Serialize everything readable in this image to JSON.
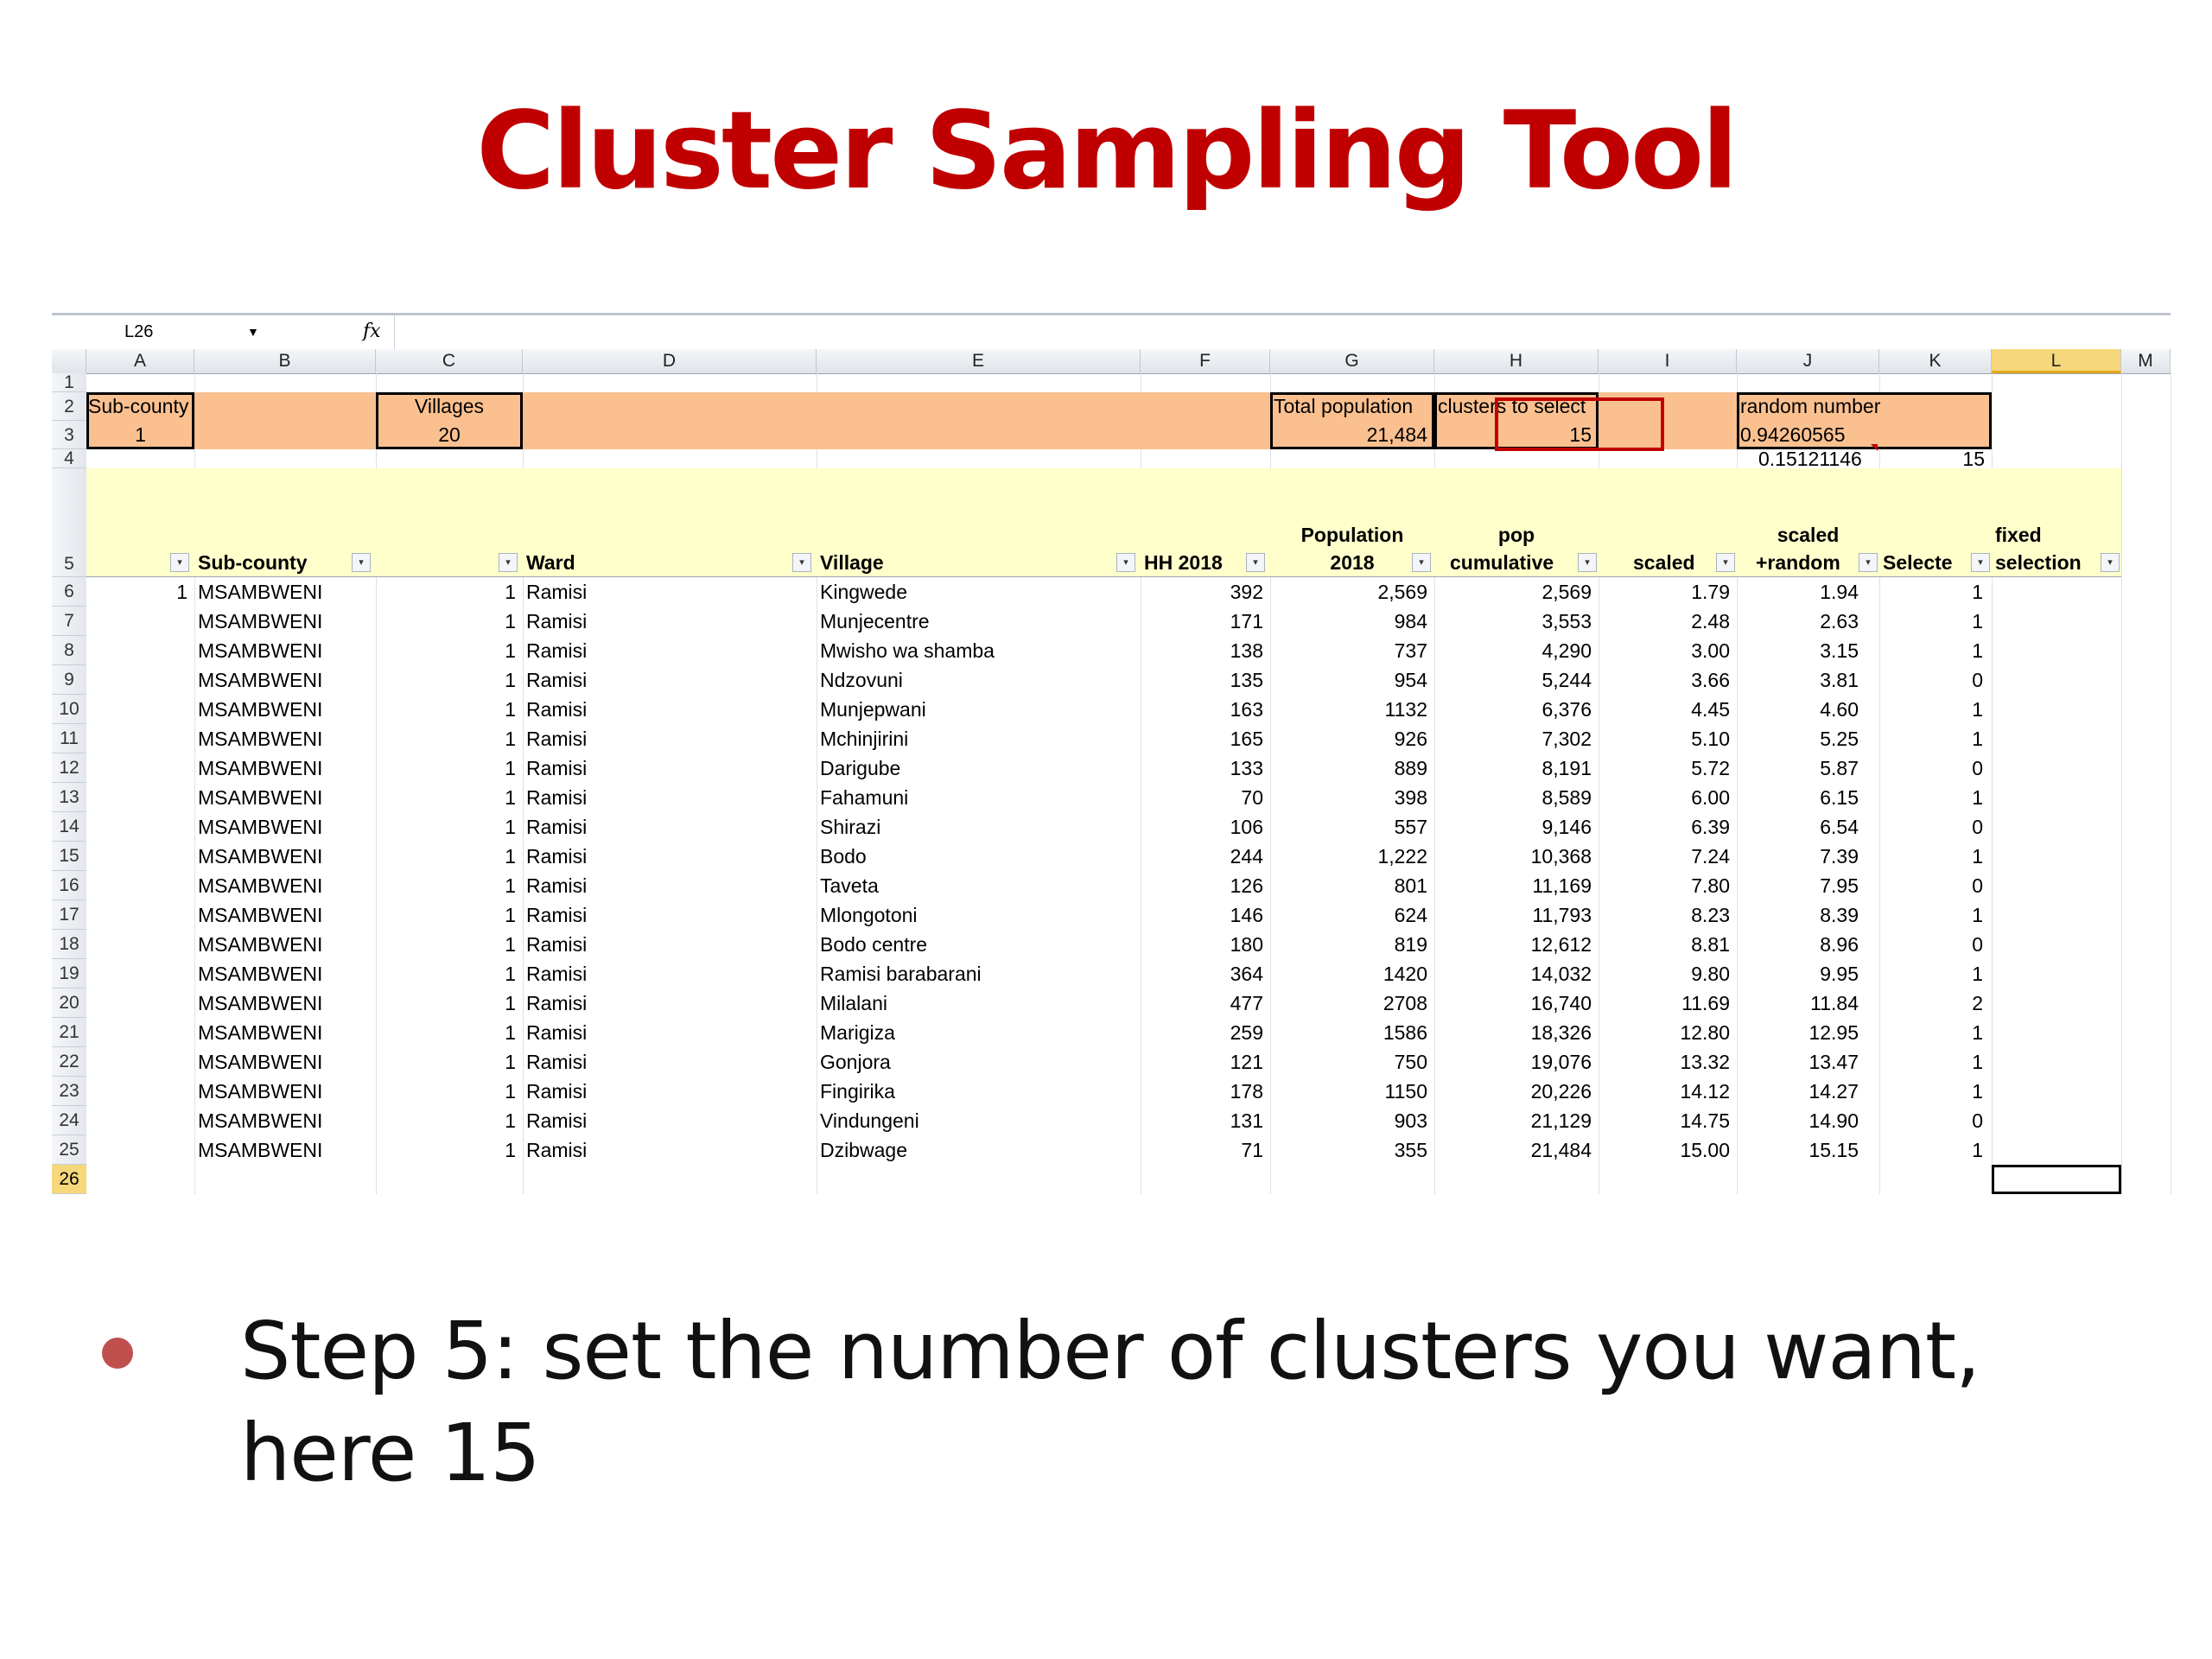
{
  "slide": {
    "title": "Cluster Sampling Tool",
    "bullet": "Step 5: set the number of clusters you want, here 15"
  },
  "sheet": {
    "name_box": "L26",
    "fx_label": "fx",
    "columns": [
      "A",
      "B",
      "C",
      "D",
      "E",
      "F",
      "G",
      "H",
      "I",
      "J",
      "K",
      "L",
      "M"
    ],
    "summary": {
      "subcounty_label": "Sub-county",
      "subcounty_value": "1",
      "villages_label": "Villages",
      "villages_value": "20",
      "total_pop_label": "Total population",
      "total_pop_value": "21,484",
      "clusters_label": "clusters to select",
      "clusters_value": "15",
      "random_label": "random number",
      "random_value": "0.94260565",
      "step_value": "0.15121146",
      "k4_value": "15"
    },
    "headers": {
      "sub_county": "Sub-county",
      "ward": "Ward",
      "village": "Village",
      "hh": "HH 2018",
      "population_1": "Population",
      "population_2": "2018",
      "pop_cum_1": "pop",
      "pop_cum_2": "cumulative",
      "scaled": "scaled",
      "scaled_random_1": "scaled",
      "scaled_random_2": "+random",
      "selected": "Selecte",
      "fixed_1": "fixed",
      "fixed_2": "selection"
    },
    "rows": [
      {
        "n": "6",
        "a": "1",
        "subcounty": "MSAMBWENI",
        "c": "1",
        "ward": "Ramisi",
        "village": "Kingwede",
        "hh": "392",
        "pop": "2,569",
        "cum": "2,569",
        "scaled": "1.79",
        "sr": "1.94",
        "sel": "1"
      },
      {
        "n": "7",
        "a": "",
        "subcounty": "MSAMBWENI",
        "c": "1",
        "ward": "Ramisi",
        "village": "Munjecentre",
        "hh": "171",
        "pop": "984",
        "cum": "3,553",
        "scaled": "2.48",
        "sr": "2.63",
        "sel": "1"
      },
      {
        "n": "8",
        "a": "",
        "subcounty": "MSAMBWENI",
        "c": "1",
        "ward": "Ramisi",
        "village": "Mwisho wa shamba",
        "hh": "138",
        "pop": "737",
        "cum": "4,290",
        "scaled": "3.00",
        "sr": "3.15",
        "sel": "1"
      },
      {
        "n": "9",
        "a": "",
        "subcounty": "MSAMBWENI",
        "c": "1",
        "ward": "Ramisi",
        "village": "Ndzovuni",
        "hh": "135",
        "pop": "954",
        "cum": "5,244",
        "scaled": "3.66",
        "sr": "3.81",
        "sel": "0"
      },
      {
        "n": "10",
        "a": "",
        "subcounty": "MSAMBWENI",
        "c": "1",
        "ward": "Ramisi",
        "village": "Munjepwani",
        "hh": "163",
        "pop": "1132",
        "cum": "6,376",
        "scaled": "4.45",
        "sr": "4.60",
        "sel": "1"
      },
      {
        "n": "11",
        "a": "",
        "subcounty": "MSAMBWENI",
        "c": "1",
        "ward": "Ramisi",
        "village": "Mchinjirini",
        "hh": "165",
        "pop": "926",
        "cum": "7,302",
        "scaled": "5.10",
        "sr": "5.25",
        "sel": "1"
      },
      {
        "n": "12",
        "a": "",
        "subcounty": "MSAMBWENI",
        "c": "1",
        "ward": "Ramisi",
        "village": "Darigube",
        "hh": "133",
        "pop": "889",
        "cum": "8,191",
        "scaled": "5.72",
        "sr": "5.87",
        "sel": "0"
      },
      {
        "n": "13",
        "a": "",
        "subcounty": "MSAMBWENI",
        "c": "1",
        "ward": "Ramisi",
        "village": "Fahamuni",
        "hh": "70",
        "pop": "398",
        "cum": "8,589",
        "scaled": "6.00",
        "sr": "6.15",
        "sel": "1"
      },
      {
        "n": "14",
        "a": "",
        "subcounty": "MSAMBWENI",
        "c": "1",
        "ward": "Ramisi",
        "village": "Shirazi",
        "hh": "106",
        "pop": "557",
        "cum": "9,146",
        "scaled": "6.39",
        "sr": "6.54",
        "sel": "0"
      },
      {
        "n": "15",
        "a": "",
        "subcounty": "MSAMBWENI",
        "c": "1",
        "ward": "Ramisi",
        "village": "Bodo",
        "hh": "244",
        "pop": "1,222",
        "cum": "10,368",
        "scaled": "7.24",
        "sr": "7.39",
        "sel": "1"
      },
      {
        "n": "16",
        "a": "",
        "subcounty": "MSAMBWENI",
        "c": "1",
        "ward": "Ramisi",
        "village": "Taveta",
        "hh": "126",
        "pop": "801",
        "cum": "11,169",
        "scaled": "7.80",
        "sr": "7.95",
        "sel": "0"
      },
      {
        "n": "17",
        "a": "",
        "subcounty": "MSAMBWENI",
        "c": "1",
        "ward": "Ramisi",
        "village": "Mlongotoni",
        "hh": "146",
        "pop": "624",
        "cum": "11,793",
        "scaled": "8.23",
        "sr": "8.39",
        "sel": "1"
      },
      {
        "n": "18",
        "a": "",
        "subcounty": "MSAMBWENI",
        "c": "1",
        "ward": "Ramisi",
        "village": "Bodo centre",
        "hh": "180",
        "pop": "819",
        "cum": "12,612",
        "scaled": "8.81",
        "sr": "8.96",
        "sel": "0"
      },
      {
        "n": "19",
        "a": "",
        "subcounty": "MSAMBWENI",
        "c": "1",
        "ward": "Ramisi",
        "village": "Ramisi barabarani",
        "hh": "364",
        "pop": "1420",
        "cum": "14,032",
        "scaled": "9.80",
        "sr": "9.95",
        "sel": "1"
      },
      {
        "n": "20",
        "a": "",
        "subcounty": "MSAMBWENI",
        "c": "1",
        "ward": "Ramisi",
        "village": "Milalani",
        "hh": "477",
        "pop": "2708",
        "cum": "16,740",
        "scaled": "11.69",
        "sr": "11.84",
        "sel": "2"
      },
      {
        "n": "21",
        "a": "",
        "subcounty": "MSAMBWENI",
        "c": "1",
        "ward": "Ramisi",
        "village": "Marigiza",
        "hh": "259",
        "pop": "1586",
        "cum": "18,326",
        "scaled": "12.80",
        "sr": "12.95",
        "sel": "1"
      },
      {
        "n": "22",
        "a": "",
        "subcounty": "MSAMBWENI",
        "c": "1",
        "ward": "Ramisi",
        "village": "Gonjora",
        "hh": "121",
        "pop": "750",
        "cum": "19,076",
        "scaled": "13.32",
        "sr": "13.47",
        "sel": "1"
      },
      {
        "n": "23",
        "a": "",
        "subcounty": "MSAMBWENI",
        "c": "1",
        "ward": "Ramisi",
        "village": "Fingirika",
        "hh": "178",
        "pop": "1150",
        "cum": "20,226",
        "scaled": "14.12",
        "sr": "14.27",
        "sel": "1"
      },
      {
        "n": "24",
        "a": "",
        "subcounty": "MSAMBWENI",
        "c": "1",
        "ward": "Ramisi",
        "village": "Vindungeni",
        "hh": "131",
        "pop": "903",
        "cum": "21,129",
        "scaled": "14.75",
        "sr": "14.90",
        "sel": "0"
      },
      {
        "n": "25",
        "a": "",
        "subcounty": "MSAMBWENI",
        "c": "1",
        "ward": "Ramisi",
        "village": "Dzibwage",
        "hh": "71",
        "pop": "355",
        "cum": "21,484",
        "scaled": "15.00",
        "sr": "15.15",
        "sel": "1"
      }
    ],
    "row_numbers": [
      "1",
      "2",
      "3",
      "4",
      "5",
      "26"
    ]
  }
}
